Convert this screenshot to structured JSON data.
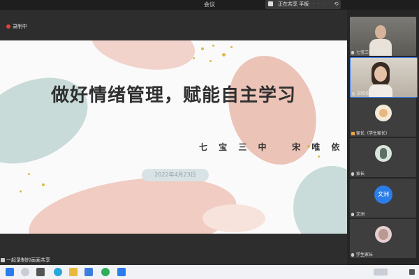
{
  "topbar": {
    "title": "会议",
    "share_label": "正在共享 平板",
    "back_glyph": "⟲"
  },
  "meeting": {
    "rec_label": "录制中",
    "caption_label": "一起录制的画面共享"
  },
  "slide": {
    "title": "做好情绪管理，赋能自主学习",
    "author": "七 宝 三 中   宋 唯 依",
    "date": "2022年4月23日"
  },
  "participants": [
    {
      "name": "七宝三中 宋唯依",
      "kind": "video-man"
    },
    {
      "name": "宋唯依",
      "kind": "video-woman"
    },
    {
      "name": "家长（学生家长）",
      "kind": "avatar-cartoon"
    },
    {
      "name": "家长",
      "kind": "avatar-photo"
    },
    {
      "name": "文洲",
      "kind": "avatar-initial",
      "initial": "文洲"
    },
    {
      "name": "学生家长",
      "kind": "avatar-photo2"
    }
  ],
  "colors": {
    "accent_blue": "#2b7de9",
    "record_red": "#e0433a",
    "pink": "#e9b8ad",
    "teal": "#b9d1cf"
  }
}
